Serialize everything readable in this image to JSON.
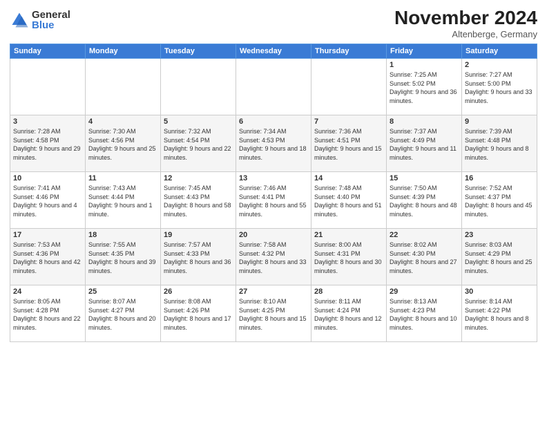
{
  "logo": {
    "general": "General",
    "blue": "Blue"
  },
  "title": "November 2024",
  "location": "Altenberge, Germany",
  "days_header": [
    "Sunday",
    "Monday",
    "Tuesday",
    "Wednesday",
    "Thursday",
    "Friday",
    "Saturday"
  ],
  "weeks": [
    [
      {
        "day": "",
        "info": ""
      },
      {
        "day": "",
        "info": ""
      },
      {
        "day": "",
        "info": ""
      },
      {
        "day": "",
        "info": ""
      },
      {
        "day": "",
        "info": ""
      },
      {
        "day": "1",
        "info": "Sunrise: 7:25 AM\nSunset: 5:02 PM\nDaylight: 9 hours and 36 minutes."
      },
      {
        "day": "2",
        "info": "Sunrise: 7:27 AM\nSunset: 5:00 PM\nDaylight: 9 hours and 33 minutes."
      }
    ],
    [
      {
        "day": "3",
        "info": "Sunrise: 7:28 AM\nSunset: 4:58 PM\nDaylight: 9 hours and 29 minutes."
      },
      {
        "day": "4",
        "info": "Sunrise: 7:30 AM\nSunset: 4:56 PM\nDaylight: 9 hours and 25 minutes."
      },
      {
        "day": "5",
        "info": "Sunrise: 7:32 AM\nSunset: 4:54 PM\nDaylight: 9 hours and 22 minutes."
      },
      {
        "day": "6",
        "info": "Sunrise: 7:34 AM\nSunset: 4:53 PM\nDaylight: 9 hours and 18 minutes."
      },
      {
        "day": "7",
        "info": "Sunrise: 7:36 AM\nSunset: 4:51 PM\nDaylight: 9 hours and 15 minutes."
      },
      {
        "day": "8",
        "info": "Sunrise: 7:37 AM\nSunset: 4:49 PM\nDaylight: 9 hours and 11 minutes."
      },
      {
        "day": "9",
        "info": "Sunrise: 7:39 AM\nSunset: 4:48 PM\nDaylight: 9 hours and 8 minutes."
      }
    ],
    [
      {
        "day": "10",
        "info": "Sunrise: 7:41 AM\nSunset: 4:46 PM\nDaylight: 9 hours and 4 minutes."
      },
      {
        "day": "11",
        "info": "Sunrise: 7:43 AM\nSunset: 4:44 PM\nDaylight: 9 hours and 1 minute."
      },
      {
        "day": "12",
        "info": "Sunrise: 7:45 AM\nSunset: 4:43 PM\nDaylight: 8 hours and 58 minutes."
      },
      {
        "day": "13",
        "info": "Sunrise: 7:46 AM\nSunset: 4:41 PM\nDaylight: 8 hours and 55 minutes."
      },
      {
        "day": "14",
        "info": "Sunrise: 7:48 AM\nSunset: 4:40 PM\nDaylight: 8 hours and 51 minutes."
      },
      {
        "day": "15",
        "info": "Sunrise: 7:50 AM\nSunset: 4:39 PM\nDaylight: 8 hours and 48 minutes."
      },
      {
        "day": "16",
        "info": "Sunrise: 7:52 AM\nSunset: 4:37 PM\nDaylight: 8 hours and 45 minutes."
      }
    ],
    [
      {
        "day": "17",
        "info": "Sunrise: 7:53 AM\nSunset: 4:36 PM\nDaylight: 8 hours and 42 minutes."
      },
      {
        "day": "18",
        "info": "Sunrise: 7:55 AM\nSunset: 4:35 PM\nDaylight: 8 hours and 39 minutes."
      },
      {
        "day": "19",
        "info": "Sunrise: 7:57 AM\nSunset: 4:33 PM\nDaylight: 8 hours and 36 minutes."
      },
      {
        "day": "20",
        "info": "Sunrise: 7:58 AM\nSunset: 4:32 PM\nDaylight: 8 hours and 33 minutes."
      },
      {
        "day": "21",
        "info": "Sunrise: 8:00 AM\nSunset: 4:31 PM\nDaylight: 8 hours and 30 minutes."
      },
      {
        "day": "22",
        "info": "Sunrise: 8:02 AM\nSunset: 4:30 PM\nDaylight: 8 hours and 27 minutes."
      },
      {
        "day": "23",
        "info": "Sunrise: 8:03 AM\nSunset: 4:29 PM\nDaylight: 8 hours and 25 minutes."
      }
    ],
    [
      {
        "day": "24",
        "info": "Sunrise: 8:05 AM\nSunset: 4:28 PM\nDaylight: 8 hours and 22 minutes."
      },
      {
        "day": "25",
        "info": "Sunrise: 8:07 AM\nSunset: 4:27 PM\nDaylight: 8 hours and 20 minutes."
      },
      {
        "day": "26",
        "info": "Sunrise: 8:08 AM\nSunset: 4:26 PM\nDaylight: 8 hours and 17 minutes."
      },
      {
        "day": "27",
        "info": "Sunrise: 8:10 AM\nSunset: 4:25 PM\nDaylight: 8 hours and 15 minutes."
      },
      {
        "day": "28",
        "info": "Sunrise: 8:11 AM\nSunset: 4:24 PM\nDaylight: 8 hours and 12 minutes."
      },
      {
        "day": "29",
        "info": "Sunrise: 8:13 AM\nSunset: 4:23 PM\nDaylight: 8 hours and 10 minutes."
      },
      {
        "day": "30",
        "info": "Sunrise: 8:14 AM\nSunset: 4:22 PM\nDaylight: 8 hours and 8 minutes."
      }
    ]
  ]
}
